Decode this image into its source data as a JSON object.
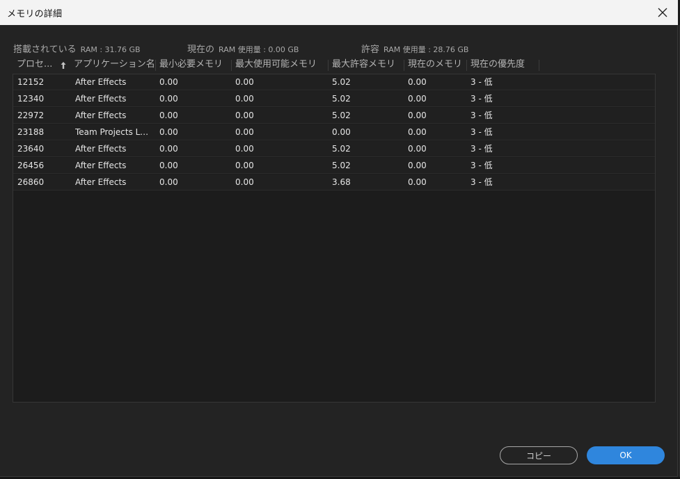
{
  "window": {
    "title": "メモリの詳細"
  },
  "summary": {
    "installed_label": "搭載されている",
    "installed_value": "RAM : 31.76 GB",
    "current_label": "現在の",
    "current_value": "RAM 使用量 : 0.00 GB",
    "allowed_label": "許容",
    "allowed_value": "RAM 使用量 : 28.76 GB"
  },
  "table": {
    "columns": [
      "プロセ...",
      "アプリケーション名",
      "最小必要メモリ",
      "最大使用可能メモリ",
      "最大許容メモリ",
      "現在のメモリ",
      "現在の優先度"
    ],
    "sort_icon": "arrow-up-icon",
    "rows": [
      [
        "12152",
        "After Effects",
        "0.00",
        "0.00",
        "5.02",
        "0.00",
        "3 - 低"
      ],
      [
        "12340",
        "After Effects",
        "0.00",
        "0.00",
        "5.02",
        "0.00",
        "3 - 低"
      ],
      [
        "22972",
        "After Effects",
        "0.00",
        "0.00",
        "5.02",
        "0.00",
        "3 - 低"
      ],
      [
        "23188",
        "Team Projects Lo...",
        "0.00",
        "0.00",
        "0.00",
        "0.00",
        "3 - 低"
      ],
      [
        "23640",
        "After Effects",
        "0.00",
        "0.00",
        "5.02",
        "0.00",
        "3 - 低"
      ],
      [
        "26456",
        "After Effects",
        "0.00",
        "0.00",
        "5.02",
        "0.00",
        "3 - 低"
      ],
      [
        "26860",
        "After Effects",
        "0.00",
        "0.00",
        "3.68",
        "0.00",
        "3 - 低"
      ]
    ]
  },
  "buttons": {
    "copy": "コピー",
    "ok": "OK"
  },
  "colors": {
    "accent": "#2f86dd",
    "background": "#232323",
    "titlebar": "#f3f3f3"
  }
}
